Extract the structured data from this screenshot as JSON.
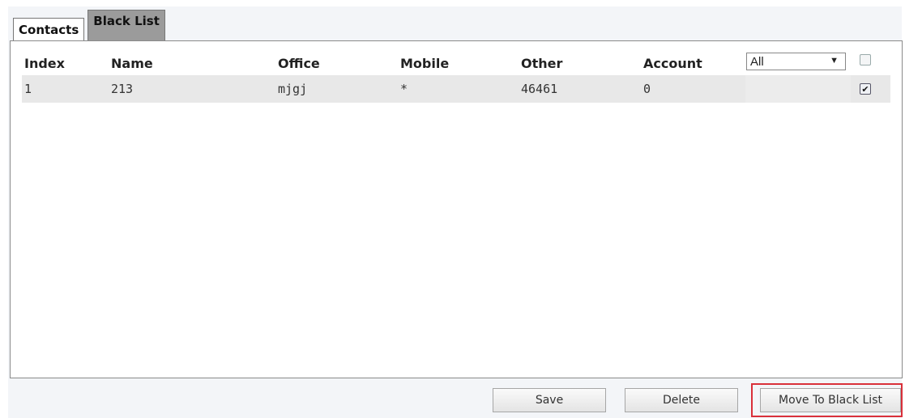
{
  "tabs": [
    {
      "label": "Contacts",
      "active": true
    },
    {
      "label": "Black List",
      "active": false
    }
  ],
  "table": {
    "headers": [
      "Index",
      "Name",
      "Office",
      "Mobile",
      "Other",
      "Account"
    ],
    "rows": [
      {
        "index": "1",
        "name": "213",
        "office": "mjgj",
        "mobile": "*",
        "other": "46461",
        "account": "0",
        "checked": true
      }
    ]
  },
  "filter": {
    "selected": "All"
  },
  "buttons": {
    "save": "Save",
    "delete": "Delete",
    "move": "Move To Black List"
  },
  "colors": {
    "highlight": "#d9303a",
    "inactive_tab": "#9b9b9b",
    "row_bg": "#e8e8e8"
  }
}
